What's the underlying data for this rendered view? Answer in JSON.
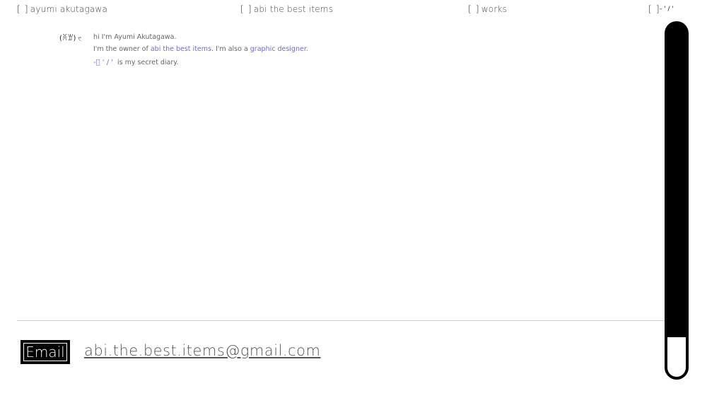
{
  "nav": {
    "items": [
      {
        "bracket_open": "[",
        "bracket_close": "]",
        "label": "ayumi akutagawa"
      },
      {
        "bracket_open": "[",
        "bracket_close": "]",
        "label": "abi the best items"
      },
      {
        "bracket_open": "[",
        "bracket_close": "]",
        "label": "works"
      },
      {
        "bracket_open": "[",
        "bracket_close": "]",
        "label": ""
      }
    ],
    "corner_glyph": "- ' / '"
  },
  "intro": {
    "face": "(ꐦꑣ)",
    "face_mark": "੯",
    "line1": "hi I'm Ayumi Akutagawa.",
    "line2_pre": "I'm the owner of ",
    "line2_link1": "abi the best items",
    "line2_mid": ". I'm also a ",
    "line2_link2": "graphic designer",
    "line2_post": ".",
    "line3_deco": "-ﾞ  ' / '",
    "line3_text": "is my secret diary."
  },
  "footer": {
    "email_label": "Email",
    "email_address": "abi.the.best.items@gmail.com"
  },
  "scrollbar": {
    "position": 0.88
  },
  "colors": {
    "link": "#6b6bd9",
    "accent": "#000000"
  }
}
